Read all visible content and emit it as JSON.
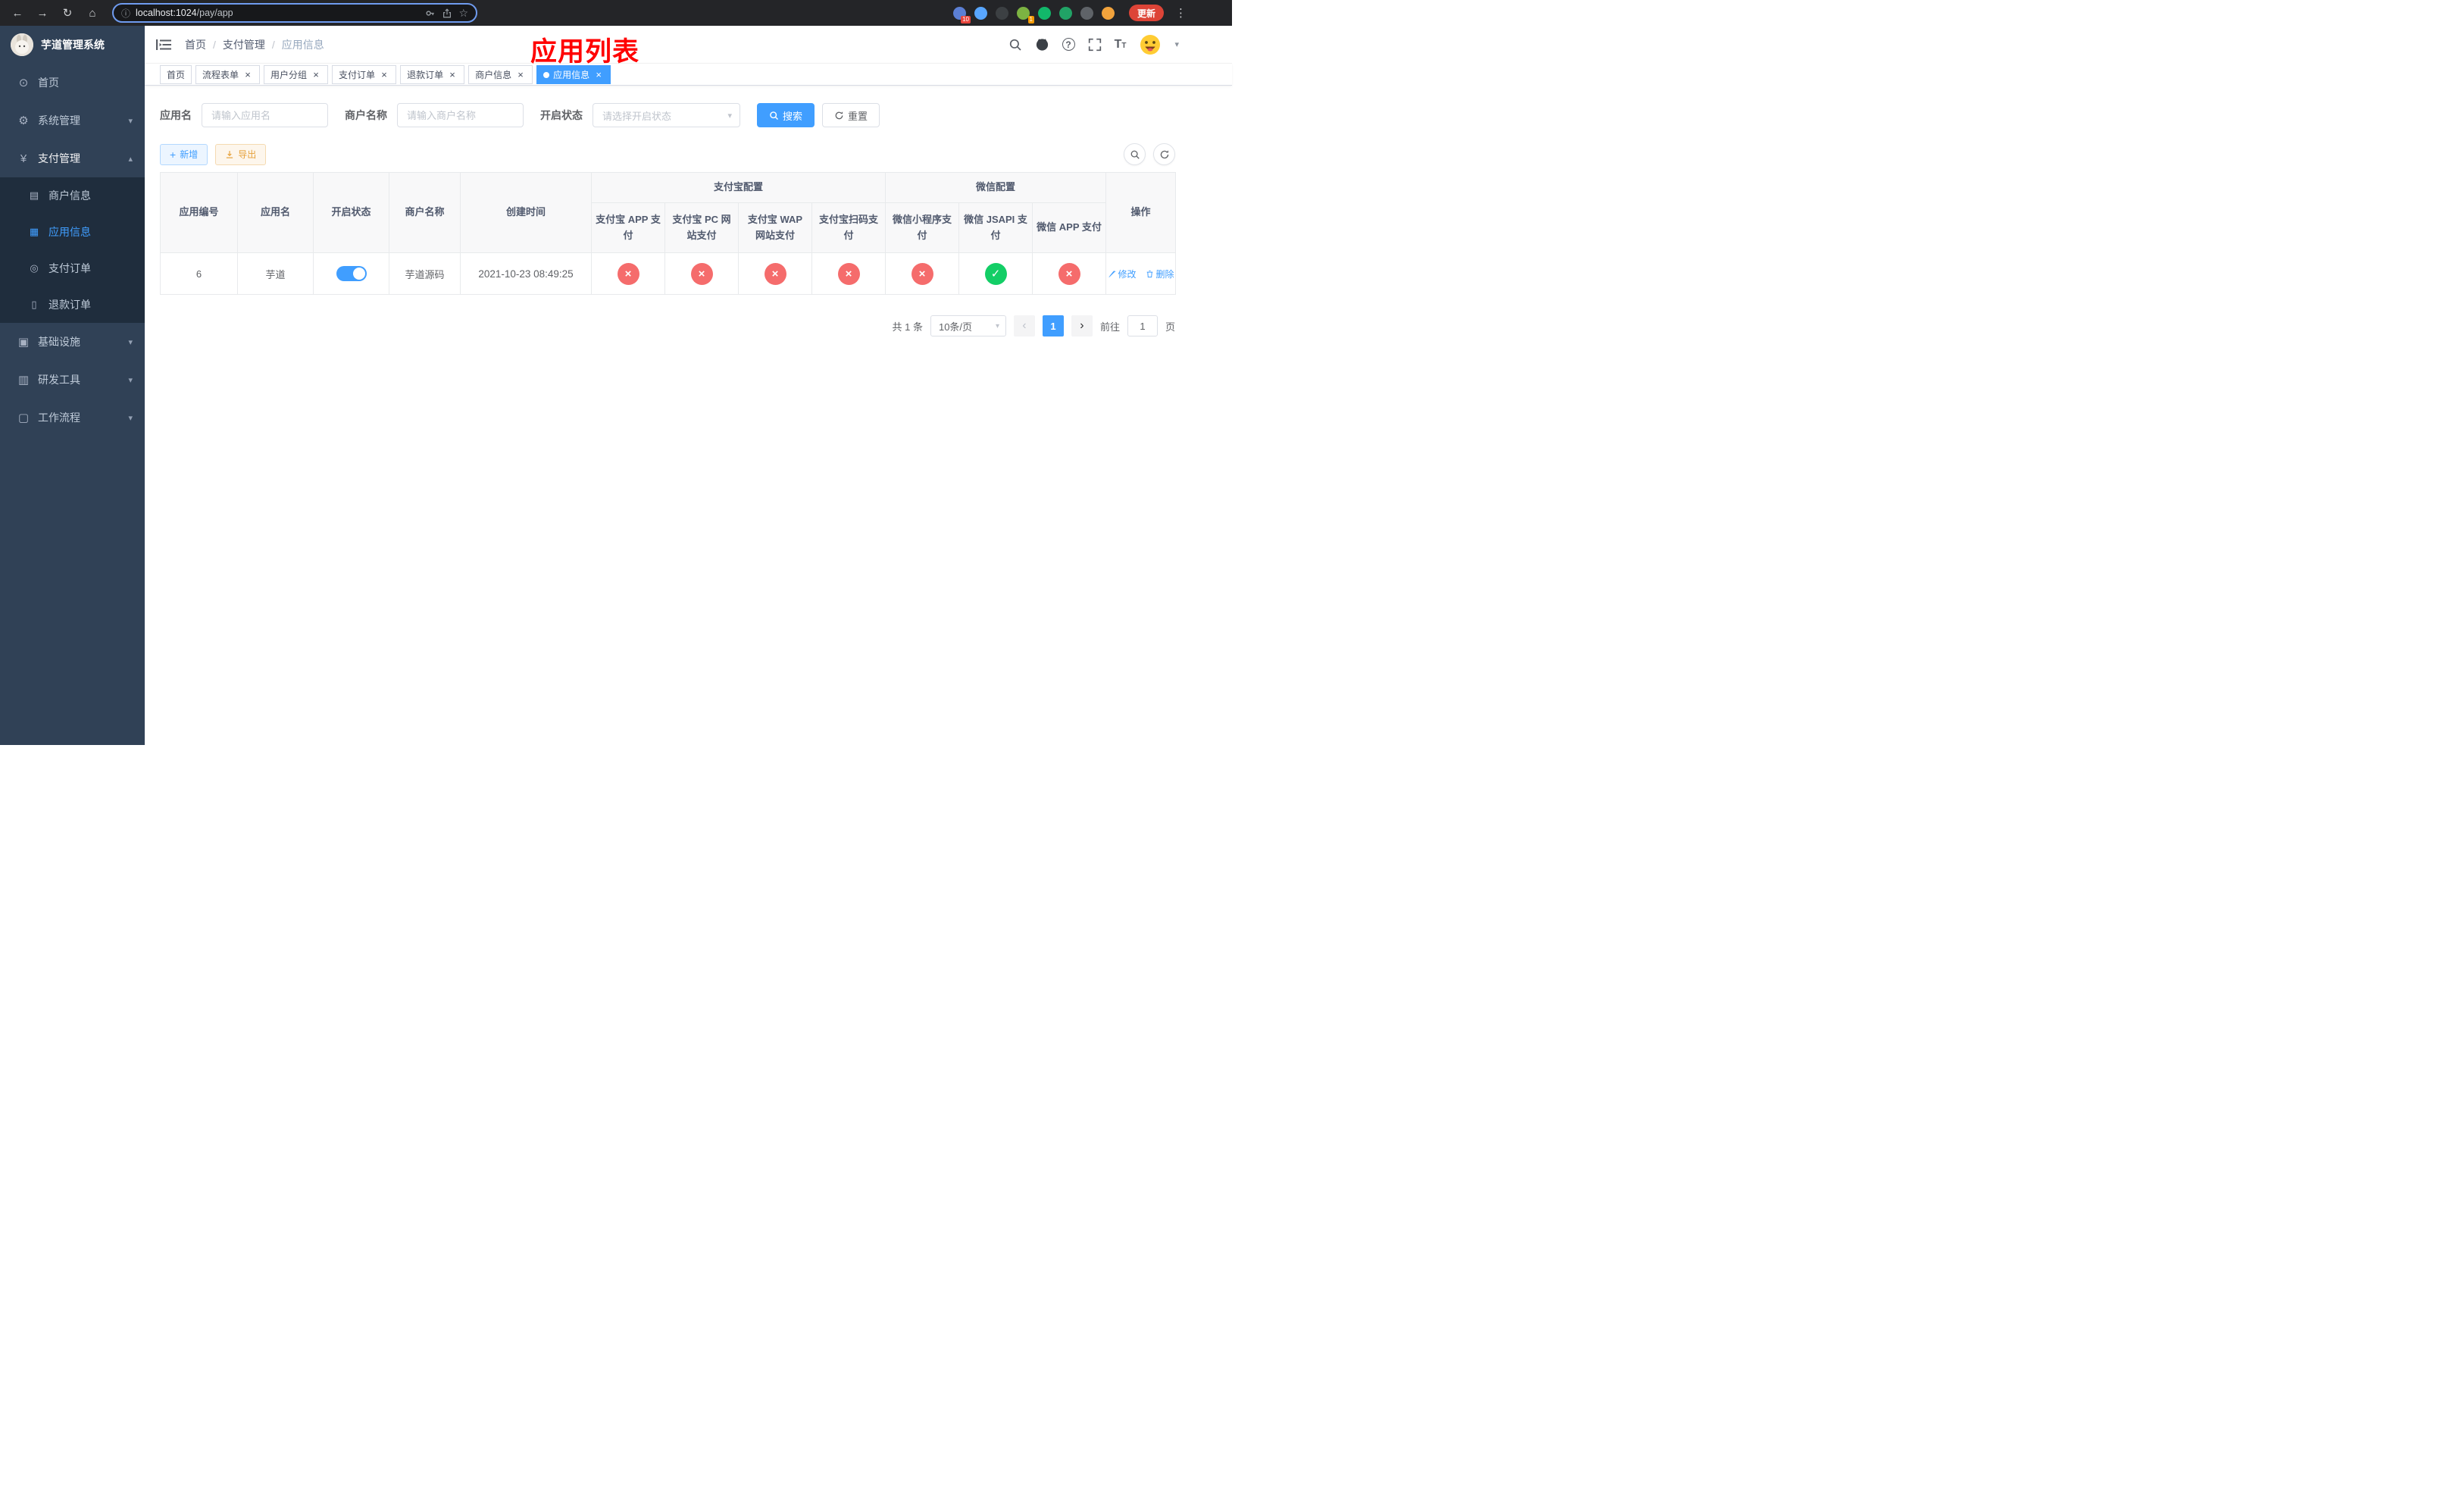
{
  "colors": {
    "accent": "#409eff",
    "danger": "#f56c6c",
    "success": "#13ce66",
    "warning": "#e6a23c",
    "annotation": "#ff0000",
    "sidebar_bg": "#304156",
    "submenu_bg": "#1f2d3d"
  },
  "icons": {
    "back": "←",
    "forward": "→",
    "reload": "↻",
    "home": "⌂",
    "info": "ⓘ",
    "star": "☆",
    "kebab": "⋮",
    "close": "×",
    "check": "✓",
    "cross": "×",
    "plus": "+",
    "chevron_down": "▾",
    "chevron_up": "▴",
    "caret_down": "▾",
    "prev": "‹",
    "next": "›",
    "question": "?",
    "letter_T_big": "T",
    "letter_T_small": "T",
    "menu_home": "⊙",
    "menu_system": "⚙",
    "menu_pay": "¥",
    "menu_merchant": "▤",
    "menu_app": "▦",
    "menu_order": "◎",
    "menu_refund": "▯",
    "menu_infra": "▣",
    "menu_tools": "▥",
    "menu_flow": "▢"
  },
  "browser": {
    "url_host": "localhost:1024",
    "url_path": "/pay/app",
    "update_label": "更新",
    "extensions": [
      {
        "name": "extension-pin",
        "color": "#5b7fd4",
        "badge": "10",
        "badge_color": "#e8453c"
      },
      {
        "name": "extension-blue",
        "color": "#58a6ff"
      },
      {
        "name": "extension-dark",
        "color": "#3c4043"
      },
      {
        "name": "extension-green-avatar",
        "color": "#7cb342",
        "badge": "1",
        "badge_color": "#f29900"
      },
      {
        "name": "extension-green-check",
        "color": "#12b76a"
      },
      {
        "name": "extension-chat",
        "color": "#21a366"
      },
      {
        "name": "extension-pinwheel",
        "color": "#5f6368"
      },
      {
        "name": "extension-face",
        "color": "#f2a33c"
      }
    ]
  },
  "sidebar": {
    "title": "芋道管理系统",
    "items": [
      {
        "label": "首页"
      },
      {
        "label": "系统管理"
      },
      {
        "label": "支付管理"
      },
      {
        "label": "基础设施"
      },
      {
        "label": "研发工具"
      },
      {
        "label": "工作流程"
      }
    ],
    "submenu": [
      {
        "label": "商户信息"
      },
      {
        "label": "应用信息"
      },
      {
        "label": "支付订单"
      },
      {
        "label": "退款订单"
      }
    ]
  },
  "navbar": {
    "breadcrumb": [
      "首页",
      "支付管理",
      "应用信息"
    ],
    "separator": "/",
    "annotation": "应用列表"
  },
  "tabs": [
    {
      "label": "首页"
    },
    {
      "label": "流程表单"
    },
    {
      "label": "用户分组"
    },
    {
      "label": "支付订单"
    },
    {
      "label": "退款订单"
    },
    {
      "label": "商户信息"
    },
    {
      "label": "应用信息"
    }
  ],
  "filters": {
    "app_name_label": "应用名",
    "app_name_placeholder": "请输入应用名",
    "merchant_label": "商户名称",
    "merchant_placeholder": "请输入商户名称",
    "status_label": "开启状态",
    "status_placeholder": "请选择开启状态",
    "search_label": "搜索",
    "reset_label": "重置"
  },
  "toolbar": {
    "add_label": "新增",
    "export_label": "导出"
  },
  "table": {
    "col_headers": [
      "应用编号",
      "应用名",
      "开启状态",
      "商户名称",
      "创建时间",
      "操作"
    ],
    "group_alipay": "支付宝配置",
    "group_wechat": "微信配置",
    "sub_headers": [
      "支付宝 APP 支付",
      "支付宝 PC 网站支付",
      "支付宝 WAP 网站支付",
      "支付宝扫码支付",
      "微信小程序支付",
      "微信 JSAPI 支付",
      "微信 APP 支付"
    ],
    "row": {
      "id": "6",
      "name": "芋道",
      "enabled": true,
      "merchant": "芋道源码",
      "created_at": "2021-10-23 08:49:25",
      "configs": [
        false,
        false,
        false,
        false,
        false,
        true,
        false
      ],
      "edit_label": "修改",
      "delete_label": "删除"
    }
  },
  "pagination": {
    "total": "共 1 条",
    "page_size": "10条/页",
    "page": "1",
    "goto_label": "前往",
    "goto_value": "1",
    "unit": "页"
  }
}
